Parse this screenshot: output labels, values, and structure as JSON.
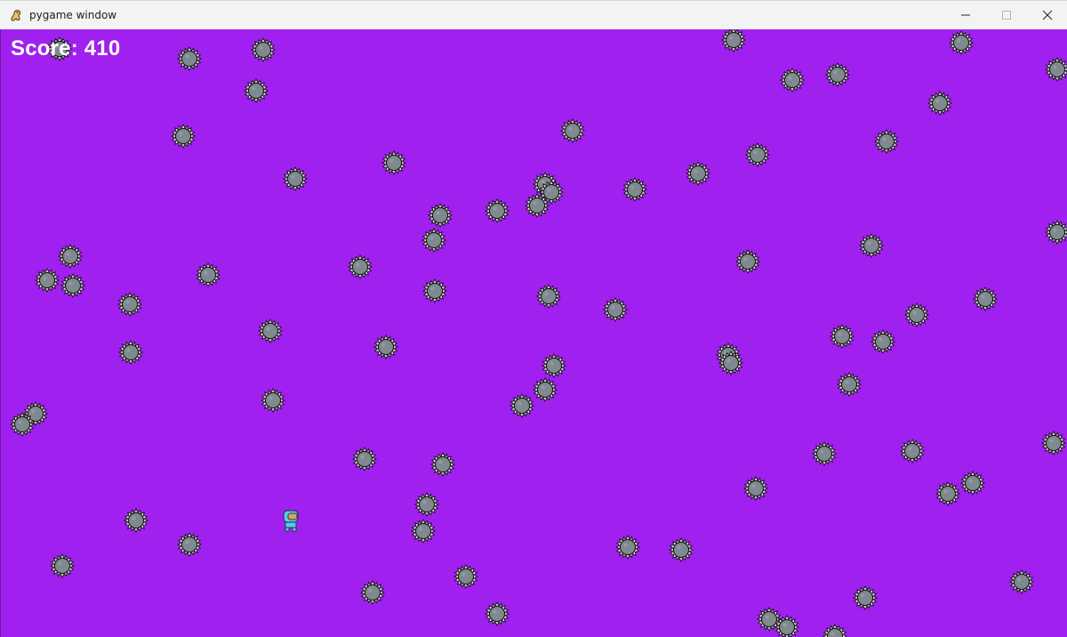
{
  "window": {
    "title": "pygame window",
    "icon": "pygame-snake-icon",
    "controls": [
      "minimize",
      "maximize",
      "close"
    ]
  },
  "game": {
    "background_color": "#a020f0",
    "score_text": "Score: 410",
    "player": {
      "icon": "astronaut-player-icon"
    },
    "obstacle": {
      "icon": "spiked-mine-icon",
      "color": "#808890"
    }
  }
}
